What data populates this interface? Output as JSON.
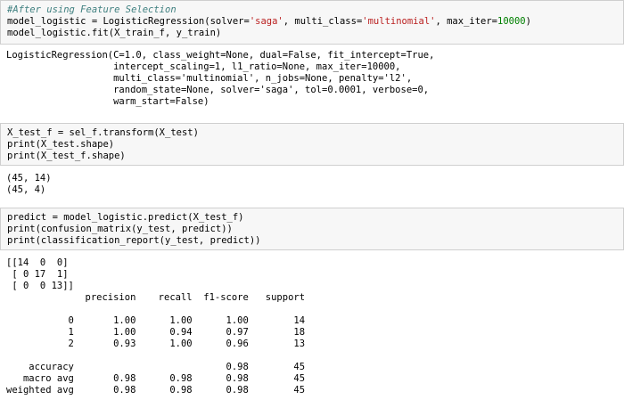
{
  "cell1": {
    "comment": "#After using Feature Selection",
    "line2": {
      "pre": "model_logistic = LogisticRegression(solver=",
      "s1": "'saga'",
      "mid": ", multi_class=",
      "s2": "'multinomial'",
      "mid2": ", max_iter=",
      "n1": "10000",
      "post": ")"
    },
    "line3": "model_logistic.fit(X_train_f, y_train)"
  },
  "out1": "LogisticRegression(C=1.0, class_weight=None, dual=False, fit_intercept=True,\n                   intercept_scaling=1, l1_ratio=None, max_iter=10000,\n                   multi_class='multinomial', n_jobs=None, penalty='l2',\n                   random_state=None, solver='saga', tol=0.0001, verbose=0,\n                   warm_start=False)",
  "cell2": "X_test_f = sel_f.transform(X_test)\nprint(X_test.shape)\nprint(X_test_f.shape)",
  "out2": "(45, 14)\n(45, 4)",
  "cell3": "predict = model_logistic.predict(X_test_f)\nprint(confusion_matrix(y_test, predict))\nprint(classification_report(y_test, predict))",
  "out3": "[[14  0  0]\n [ 0 17  1]\n [ 0  0 13]]\n              precision    recall  f1-score   support\n\n           0       1.00      1.00      1.00        14\n           1       1.00      0.94      0.97        18\n           2       0.93      1.00      0.96        13\n\n    accuracy                           0.98        45\n   macro avg       0.98      0.98      0.98        45\nweighted avg       0.98      0.98      0.98        45"
}
